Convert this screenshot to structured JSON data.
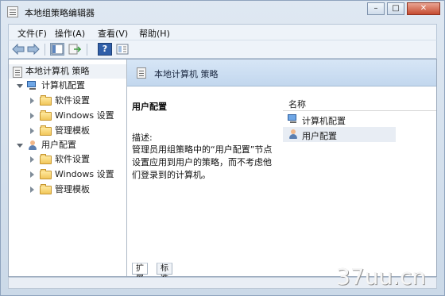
{
  "window": {
    "title": "本地组策略编辑器"
  },
  "titlebar": {
    "minimize_symbol": "–",
    "maximize_symbol": "□",
    "close_symbol": "✕"
  },
  "menubar": [
    "文件(F)",
    "操作(A)",
    "查看(V)",
    "帮助(H)"
  ],
  "toolbar": {
    "back_icon": "back-arrow-icon",
    "forward_icon": "forward-arrow-icon",
    "help_symbol": "?"
  },
  "tree": {
    "root": "本地计算机 策略",
    "computer_config": "计算机配置",
    "computer_children": [
      "软件设置",
      "Windows 设置",
      "管理模板"
    ],
    "user_config": "用户配置",
    "user_children": [
      "软件设置",
      "Windows 设置",
      "管理模板"
    ]
  },
  "right": {
    "header": "本地计算机 策略",
    "detail_title": "用户配置",
    "description_label": "描述:",
    "description_text": "管理员用组策略中的“用户配置”节点设置应用到用户的策略，而不考虑他们登录到的计算机。",
    "list_header": "名称",
    "list_items": [
      "计算机配置",
      "用户配置"
    ]
  },
  "tabs": [
    "扩展",
    "标准"
  ],
  "watermark": "37uu.cn"
}
